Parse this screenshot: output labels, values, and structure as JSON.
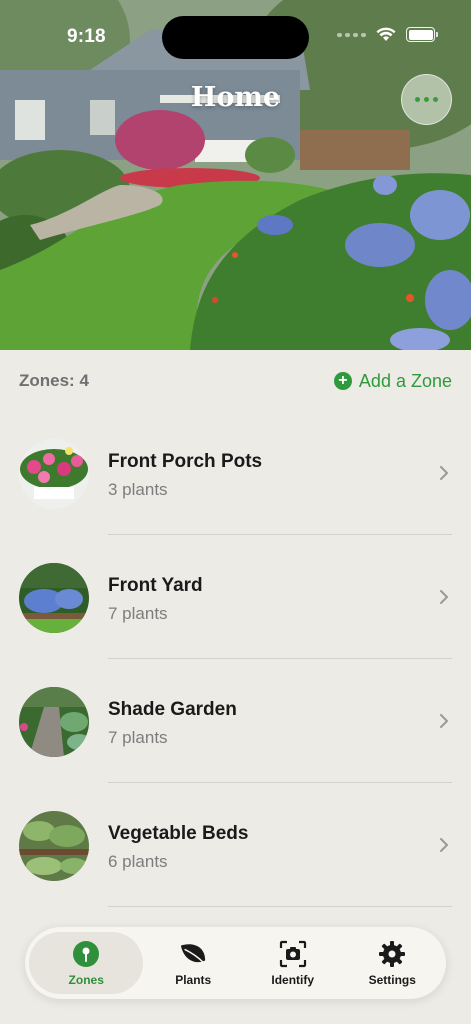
{
  "status_bar": {
    "time": "9:18"
  },
  "header": {
    "title": "Home"
  },
  "zones_header": {
    "count_label": "Zones: 4",
    "add_label": "Add a Zone"
  },
  "zones": [
    {
      "name": "Front Porch Pots",
      "count": "3 plants"
    },
    {
      "name": "Front Yard",
      "count": "7 plants"
    },
    {
      "name": "Shade Garden",
      "count": "7 plants"
    },
    {
      "name": "Vegetable Beds",
      "count": "6 plants"
    }
  ],
  "tabs": [
    {
      "label": "Zones",
      "icon": "location-pin-icon",
      "active": true
    },
    {
      "label": "Plants",
      "icon": "leaf-icon",
      "active": false
    },
    {
      "label": "Identify",
      "icon": "camera-scan-icon",
      "active": false
    },
    {
      "label": "Settings",
      "icon": "gear-icon",
      "active": false
    }
  ],
  "colors": {
    "accent": "#2f9a3b",
    "background": "#ecebe6",
    "tab_bar": "#f6f5f0"
  }
}
